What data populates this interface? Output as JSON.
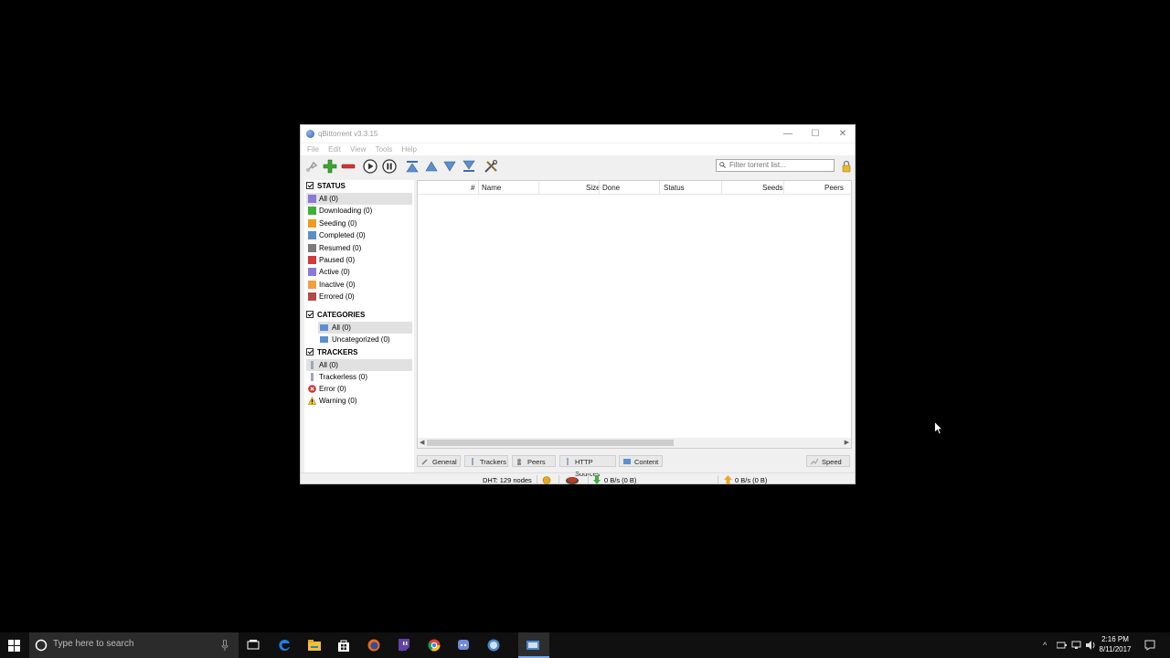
{
  "window": {
    "title": "qBittorrent v3.3.15",
    "controls": {
      "minimize": "—",
      "maximize": "☐",
      "close": "✕"
    }
  },
  "menu": [
    "File",
    "Edit",
    "View",
    "Tools",
    "Help"
  ],
  "search": {
    "placeholder": "Filter torrent list..."
  },
  "sidebar": {
    "status_header": "STATUS",
    "status_items": [
      {
        "label": "All (0)",
        "selected": true,
        "color": "#8a7ad8"
      },
      {
        "label": "Downloading (0)",
        "color": "#3fae3a"
      },
      {
        "label": "Seeding (0)",
        "color": "#f09a1e"
      },
      {
        "label": "Completed (0)",
        "color": "#5b8fbf"
      },
      {
        "label": "Resumed (0)",
        "color": "#7b7b7b"
      },
      {
        "label": "Paused (0)",
        "color": "#d23b3b"
      },
      {
        "label": "Active (0)",
        "color": "#8a7ad8"
      },
      {
        "label": "Inactive (0)",
        "color": "#f0a13c"
      },
      {
        "label": "Errored (0)",
        "color": "#b34a4a"
      }
    ],
    "categories_header": "CATEGORIES",
    "category_items": [
      {
        "label": "All (0)",
        "selected": true
      },
      {
        "label": "Uncategorized (0)"
      }
    ],
    "trackers_header": "TRACKERS",
    "tracker_items": [
      {
        "label": "All (0)",
        "selected": true
      },
      {
        "label": "Trackerless (0)"
      },
      {
        "label": "Error (0)"
      },
      {
        "label": "Warning (0)"
      }
    ]
  },
  "columns": [
    "#",
    "Name",
    "Size",
    "Done",
    "Status",
    "Seeds",
    "Peers"
  ],
  "tabs": [
    "General",
    "Trackers",
    "Peers",
    "HTTP Sources",
    "Content"
  ],
  "speed_button": "Speed",
  "statusbar": {
    "dht": "DHT: 129 nodes",
    "download": "0 B/s (0 B)",
    "upload": "0 B/s (0 B)"
  },
  "taskbar": {
    "search_placeholder": "Type here to search",
    "time": "2:16 PM",
    "date": "8/11/2017"
  }
}
